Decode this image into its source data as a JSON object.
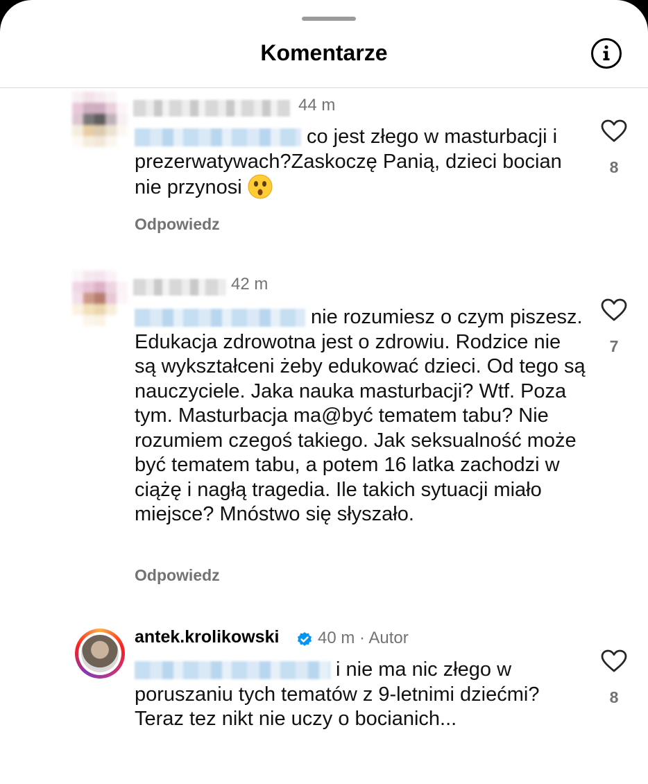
{
  "header": {
    "title": "Komentarze",
    "info_icon": "info-circle-icon"
  },
  "comments": [
    {
      "time": "44 m",
      "text": "co jest złego w masturbacji i prezerwatywach?Zaskoczę Panią, dzieci bocian nie przynosi",
      "emoji": "astonished-face-emoji",
      "reply_label": "Odpowiedz",
      "likes": "8"
    },
    {
      "time": "42 m",
      "text": "nie rozumiesz o czym piszesz. Edukacja zdrowotna jest o zdrowiu. Rodzice nie są wykształceni żeby edukować dzieci. Od tego są nauczyciele. Jaka nauka masturbacji? Wtf. Poza tym. Masturbacja ma@być tematem tabu? Nie rozumiem czegoś takiego. Jak seksualność może być tematem tabu, a potem 16 latka zachodzi w ciążę i nagłą tragedia. Ile takich sytuacji miało miejsce? Mnóstwo się słyszało.",
      "reply_label": "Odpowiedz",
      "likes": "7"
    },
    {
      "username": "antek.krolikowski",
      "time": "40 m · Autor",
      "text": "i nie ma nic złego w poruszaniu tych tematów z 9-letnimi dziećmi? Teraz tez nikt nie uczy o bocianich...",
      "likes": "8"
    }
  ],
  "colors": {
    "secondary_text": "#737373",
    "verified_blue": "#0095f6",
    "divider": "#dbdbdb"
  }
}
